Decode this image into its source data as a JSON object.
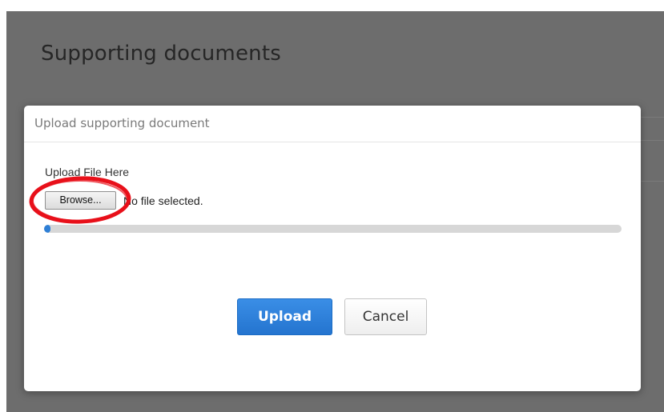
{
  "page": {
    "title": "Supporting documents"
  },
  "modal": {
    "title": "Upload supporting document",
    "field_label": "Upload File Here",
    "browse_label": "Browse...",
    "file_status": "No file selected.",
    "upload_progress": 0.01,
    "upload_label": "Upload",
    "cancel_label": "Cancel"
  },
  "colors": {
    "accent": "#2e7fd6",
    "overlay": "#6d6d6d",
    "highlight": "#e8101a"
  }
}
